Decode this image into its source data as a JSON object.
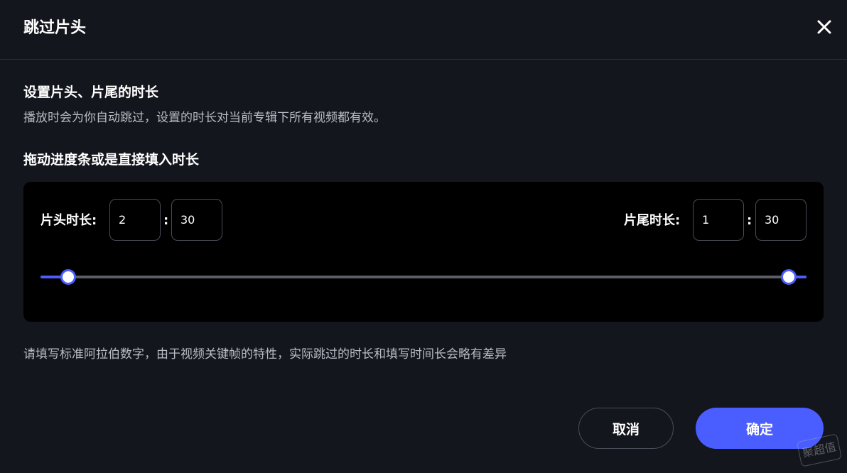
{
  "dialog": {
    "title": "跳过片头"
  },
  "section": {
    "heading": "设置片头、片尾的时长",
    "description": "播放时会为你自动跳过，设置的时长对当前专辑下所有视频都有效。"
  },
  "drag_heading": "拖动进度条或是直接填入时长",
  "intro": {
    "label": "片头时长:",
    "minutes": "2",
    "seconds": "30"
  },
  "outro": {
    "label": "片尾时长:",
    "minutes": "1",
    "seconds": "30"
  },
  "colon": ":",
  "slider": {
    "start_fraction": 0.036,
    "end_fraction": 0.977,
    "accent_color": "#4a5dff",
    "track_color": "#5b5e66"
  },
  "note": "请填写标准阿拉伯数字，由于视频关键帧的特性，实际跳过的时长和填写时间长会略有差异",
  "buttons": {
    "cancel": "取消",
    "confirm": "确定"
  },
  "watermark": "聚超值",
  "icons": {
    "close": "close-icon"
  }
}
